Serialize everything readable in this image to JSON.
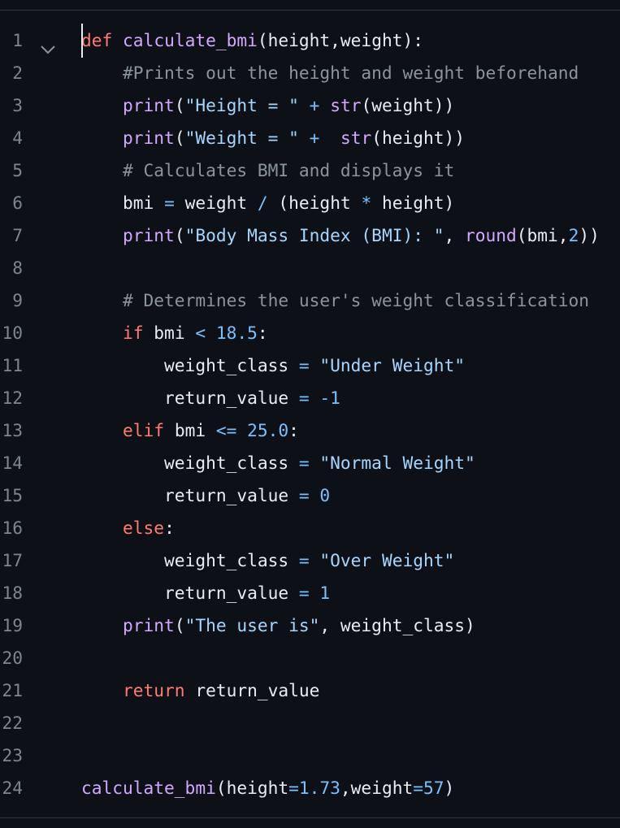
{
  "editor": {
    "language": "python",
    "lines": [
      {
        "n": "1",
        "tokens": [
          {
            "t": "def",
            "c": "kw"
          },
          {
            "t": " ",
            "c": "tx"
          },
          {
            "t": "calculate_bmi",
            "c": "fn"
          },
          {
            "t": "(height,weight):",
            "c": "tx"
          }
        ]
      },
      {
        "n": "2",
        "tokens": [
          {
            "t": "    ",
            "c": "tx"
          },
          {
            "t": "#Prints out the height and weight beforehand",
            "c": "cm"
          }
        ]
      },
      {
        "n": "3",
        "tokens": [
          {
            "t": "    ",
            "c": "tx"
          },
          {
            "t": "print",
            "c": "fn"
          },
          {
            "t": "(",
            "c": "tx"
          },
          {
            "t": "\"Height = \"",
            "c": "str"
          },
          {
            "t": " ",
            "c": "tx"
          },
          {
            "t": "+",
            "c": "op"
          },
          {
            "t": " ",
            "c": "tx"
          },
          {
            "t": "str",
            "c": "fn"
          },
          {
            "t": "(weight))",
            "c": "tx"
          }
        ]
      },
      {
        "n": "4",
        "tokens": [
          {
            "t": "    ",
            "c": "tx"
          },
          {
            "t": "print",
            "c": "fn"
          },
          {
            "t": "(",
            "c": "tx"
          },
          {
            "t": "\"Weight = \"",
            "c": "str"
          },
          {
            "t": " ",
            "c": "tx"
          },
          {
            "t": "+",
            "c": "op"
          },
          {
            "t": "  ",
            "c": "tx"
          },
          {
            "t": "str",
            "c": "fn"
          },
          {
            "t": "(height))",
            "c": "tx"
          }
        ]
      },
      {
        "n": "5",
        "tokens": [
          {
            "t": "    ",
            "c": "tx"
          },
          {
            "t": "# Calculates BMI and displays it",
            "c": "cm"
          }
        ]
      },
      {
        "n": "6",
        "tokens": [
          {
            "t": "    bmi ",
            "c": "tx"
          },
          {
            "t": "=",
            "c": "op"
          },
          {
            "t": " weight ",
            "c": "tx"
          },
          {
            "t": "/",
            "c": "op"
          },
          {
            "t": " (height ",
            "c": "tx"
          },
          {
            "t": "*",
            "c": "op"
          },
          {
            "t": " height)",
            "c": "tx"
          }
        ]
      },
      {
        "n": "7",
        "tokens": [
          {
            "t": "    ",
            "c": "tx"
          },
          {
            "t": "print",
            "c": "fn"
          },
          {
            "t": "(",
            "c": "tx"
          },
          {
            "t": "\"Body Mass Index (BMI): \"",
            "c": "str"
          },
          {
            "t": ", ",
            "c": "tx"
          },
          {
            "t": "round",
            "c": "fn"
          },
          {
            "t": "(bmi,",
            "c": "tx"
          },
          {
            "t": "2",
            "c": "num"
          },
          {
            "t": "))",
            "c": "tx"
          }
        ]
      },
      {
        "n": "8",
        "tokens": []
      },
      {
        "n": "9",
        "tokens": [
          {
            "t": "    ",
            "c": "tx"
          },
          {
            "t": "# Determines the user's weight classification",
            "c": "cm"
          }
        ]
      },
      {
        "n": "10",
        "tokens": [
          {
            "t": "    ",
            "c": "tx"
          },
          {
            "t": "if",
            "c": "kw"
          },
          {
            "t": " bmi ",
            "c": "tx"
          },
          {
            "t": "<",
            "c": "op"
          },
          {
            "t": " ",
            "c": "tx"
          },
          {
            "t": "18.5",
            "c": "num"
          },
          {
            "t": ":",
            "c": "tx"
          }
        ]
      },
      {
        "n": "11",
        "tokens": [
          {
            "t": "        weight_class ",
            "c": "tx"
          },
          {
            "t": "=",
            "c": "op"
          },
          {
            "t": " ",
            "c": "tx"
          },
          {
            "t": "\"Under Weight\"",
            "c": "str"
          }
        ]
      },
      {
        "n": "12",
        "tokens": [
          {
            "t": "        return_value ",
            "c": "tx"
          },
          {
            "t": "=",
            "c": "op"
          },
          {
            "t": " ",
            "c": "tx"
          },
          {
            "t": "-1",
            "c": "num"
          }
        ]
      },
      {
        "n": "13",
        "tokens": [
          {
            "t": "    ",
            "c": "tx"
          },
          {
            "t": "elif",
            "c": "kw"
          },
          {
            "t": " bmi ",
            "c": "tx"
          },
          {
            "t": "<=",
            "c": "op"
          },
          {
            "t": " ",
            "c": "tx"
          },
          {
            "t": "25.0",
            "c": "num"
          },
          {
            "t": ":",
            "c": "tx"
          }
        ]
      },
      {
        "n": "14",
        "tokens": [
          {
            "t": "        weight_class ",
            "c": "tx"
          },
          {
            "t": "=",
            "c": "op"
          },
          {
            "t": " ",
            "c": "tx"
          },
          {
            "t": "\"Normal Weight\"",
            "c": "str"
          }
        ]
      },
      {
        "n": "15",
        "tokens": [
          {
            "t": "        return_value ",
            "c": "tx"
          },
          {
            "t": "=",
            "c": "op"
          },
          {
            "t": " ",
            "c": "tx"
          },
          {
            "t": "0",
            "c": "num"
          }
        ]
      },
      {
        "n": "16",
        "tokens": [
          {
            "t": "    ",
            "c": "tx"
          },
          {
            "t": "else",
            "c": "kw"
          },
          {
            "t": ":",
            "c": "tx"
          }
        ]
      },
      {
        "n": "17",
        "tokens": [
          {
            "t": "        weight_class ",
            "c": "tx"
          },
          {
            "t": "=",
            "c": "op"
          },
          {
            "t": " ",
            "c": "tx"
          },
          {
            "t": "\"Over Weight\"",
            "c": "str"
          }
        ]
      },
      {
        "n": "18",
        "tokens": [
          {
            "t": "        return_value ",
            "c": "tx"
          },
          {
            "t": "=",
            "c": "op"
          },
          {
            "t": " ",
            "c": "tx"
          },
          {
            "t": "1",
            "c": "num"
          }
        ]
      },
      {
        "n": "19",
        "tokens": [
          {
            "t": "    ",
            "c": "tx"
          },
          {
            "t": "print",
            "c": "fn"
          },
          {
            "t": "(",
            "c": "tx"
          },
          {
            "t": "\"The user is\"",
            "c": "str"
          },
          {
            "t": ", weight_class)",
            "c": "tx"
          }
        ]
      },
      {
        "n": "20",
        "tokens": []
      },
      {
        "n": "21",
        "tokens": [
          {
            "t": "    ",
            "c": "tx"
          },
          {
            "t": "return",
            "c": "kw"
          },
          {
            "t": " return_value",
            "c": "tx"
          }
        ]
      },
      {
        "n": "22",
        "tokens": []
      },
      {
        "n": "23",
        "tokens": []
      },
      {
        "n": "24",
        "tokens": [
          {
            "t": "calculate_bmi",
            "c": "fn"
          },
          {
            "t": "(height",
            "c": "tx"
          },
          {
            "t": "=",
            "c": "op"
          },
          {
            "t": "1.73",
            "c": "num"
          },
          {
            "t": ",weight",
            "c": "tx"
          },
          {
            "t": "=",
            "c": "op"
          },
          {
            "t": "57",
            "c": "num"
          },
          {
            "t": ")",
            "c": "tx"
          }
        ]
      }
    ],
    "fold_icon": "chevron-down-icon"
  }
}
